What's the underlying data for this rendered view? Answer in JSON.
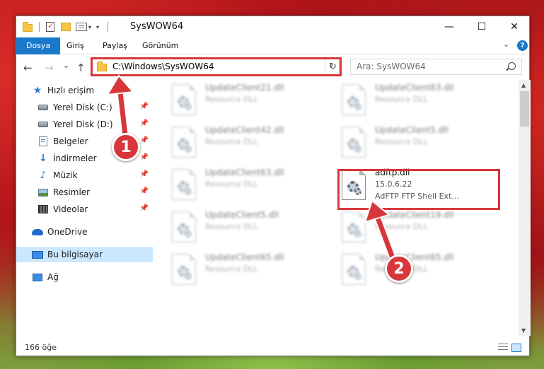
{
  "window": {
    "title": "SysWOW64",
    "controls": {
      "minimize": "—",
      "maximize": "☐",
      "close": "✕"
    }
  },
  "ribbon": {
    "tabs": [
      "Dosya",
      "Giriş",
      "Paylaş",
      "Görünüm"
    ],
    "collapse_icon": "chevron-down-icon",
    "help_label": "?"
  },
  "navigation": {
    "back": "←",
    "forward": "→",
    "recent": "⌄",
    "up": "↑",
    "address": "C:\\Windows\\SysWOW64",
    "search_placeholder": "Ara: SysWOW64"
  },
  "sidebar": {
    "quick_access": "Hızlı erişim",
    "items": [
      {
        "label": "Yerel Disk (C:)",
        "icon": "drive-icon",
        "pinned": true
      },
      {
        "label": "Yerel Disk (D:)",
        "icon": "drive-icon",
        "pinned": true
      },
      {
        "label": "Belgeler",
        "icon": "documents-icon",
        "pinned": true
      },
      {
        "label": "İndirmeler",
        "icon": "downloads-icon",
        "pinned": true
      },
      {
        "label": "Müzik",
        "icon": "music-icon",
        "pinned": true
      },
      {
        "label": "Resimler",
        "icon": "pictures-icon",
        "pinned": true
      },
      {
        "label": "Videolar",
        "icon": "videos-icon",
        "pinned": true
      }
    ],
    "onedrive": "OneDrive",
    "this_pc": "Bu bilgisayar",
    "network": "Ağ"
  },
  "files": [
    {
      "name": "UpdateClient21.dll",
      "desc": "Resource DLL",
      "blurred": true
    },
    {
      "name": "UpdateClient63.dll",
      "desc": "Resource DLL",
      "blurred": true
    },
    {
      "name": "UpdateClient42.dll",
      "desc": "Resource DLL",
      "blurred": true
    },
    {
      "name": "UpdateClient5.dll",
      "desc": "Resource DLL",
      "blurred": true
    },
    {
      "name": "UpdateClient63.dll",
      "desc": "Resource DLL",
      "blurred": true
    },
    {
      "name": "adftp.dll",
      "desc": "15.0.6.22",
      "desc2": "AdFTP FTP Shell Ext...",
      "blurred": false
    },
    {
      "name": "UpdateClient5.dll",
      "desc": "Resource DLL",
      "blurred": true
    },
    {
      "name": "UpdateClient19.dll",
      "desc": "Resource DLL",
      "blurred": true
    },
    {
      "name": "UpdateClient65.dll",
      "desc": "Resource DLL",
      "blurred": true
    },
    {
      "name": "UpdateClient65.dll",
      "desc": "Resource DLL",
      "blurred": true
    }
  ],
  "status": {
    "item_count": "166 öğe"
  },
  "annotations": {
    "step1": "1",
    "step2": "2",
    "color": "#d7373a"
  }
}
